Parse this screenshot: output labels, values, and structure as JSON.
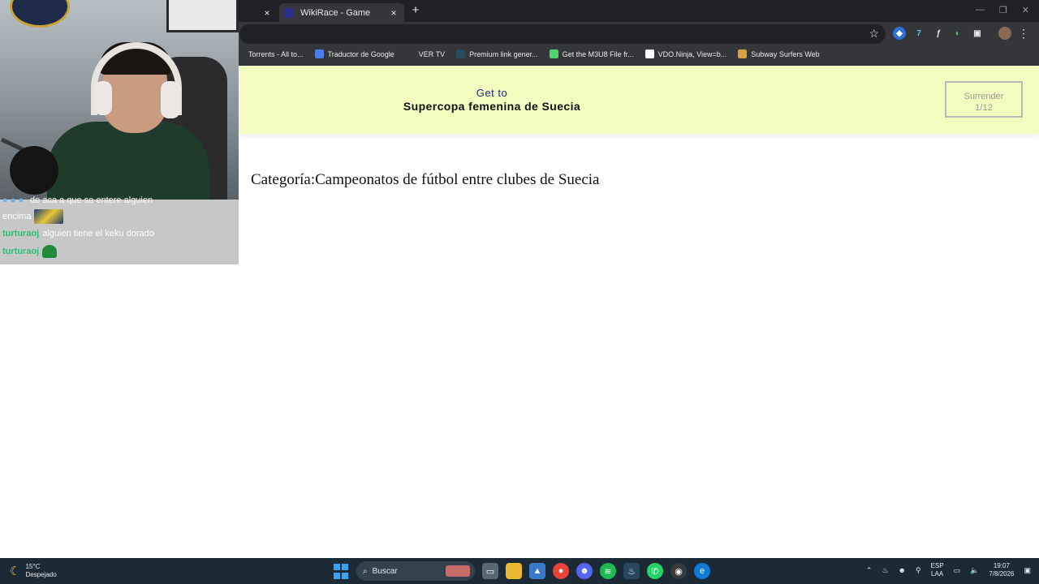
{
  "browser": {
    "tabs": [
      {
        "title": "",
        "active": false
      },
      {
        "title": "WikiRace - Game",
        "active": true
      }
    ],
    "new_tab_glyph": "+",
    "close_glyph": "×",
    "window_controls": [
      "—",
      "❐",
      "✕"
    ],
    "bookmarks": [
      {
        "label": "Torrents - All to...",
        "icon": "torrent-icon",
        "color": "#35363a"
      },
      {
        "label": "Traductor de Google",
        "icon": "google-translate-icon",
        "color": "#4a7de8"
      },
      {
        "label": "VER TV",
        "icon": "folder-icon",
        "color": "#35363a"
      },
      {
        "label": "Premium link gener...",
        "icon": "link-icon",
        "color": "#2e4a5e"
      },
      {
        "label": "Get the M3U8 File fr...",
        "icon": "green-circle-icon",
        "color": "#4fd16b"
      },
      {
        "label": "VDO.Ninja, View=b...",
        "icon": "ninja-icon",
        "color": "#ffffff"
      },
      {
        "label": "Subway Surfers Web",
        "icon": "subway-surfers-icon",
        "color": "#d8a040"
      }
    ]
  },
  "game": {
    "get_to_label": "Get to",
    "target_article": "Supercopa femenina de Suecia",
    "surrender_label": "Surrender",
    "surrender_count": "1/12",
    "current_article": "Categoría:Campeonatos de fútbol entre clubes de Suecia"
  },
  "chat": {
    "lines": [
      {
        "user": "",
        "text": "de aca a que se entere alguien",
        "emote": false
      },
      {
        "user": "",
        "text": "encima",
        "emote": true
      },
      {
        "user": "turturaoj",
        "text": "alguien tiene el keku dorado",
        "emote": false
      },
      {
        "user": "turturaoj",
        "text": "",
        "emote": true
      }
    ]
  },
  "taskbar": {
    "temperature": "15°C",
    "weather": "Despejado",
    "search_label": "Buscar",
    "language": "ESP",
    "layout": "LAA",
    "time": "19:07",
    "date": "7/8/2026"
  }
}
